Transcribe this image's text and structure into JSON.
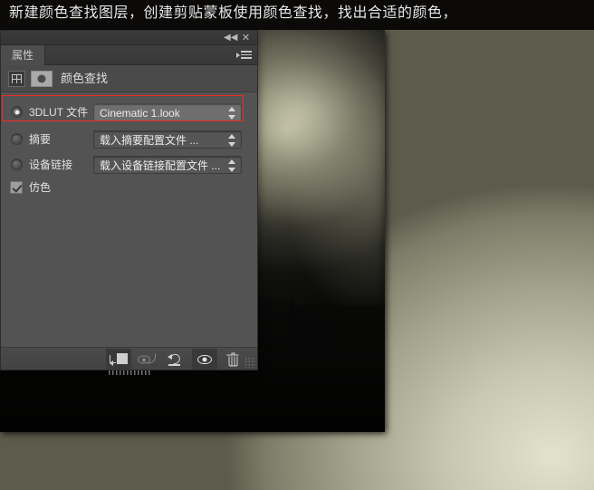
{
  "caption": {
    "text": "新建颜色查找图层，创建剪贴蒙板使用颜色查找，找出合适的颜色，"
  },
  "photo": {
    "alt_name": "dark-abbey-silhouette-photo"
  },
  "panel": {
    "titlebar": {
      "collapse_icon": "◀◀",
      "close_icon": "✕"
    },
    "tab_label": "属性",
    "header": {
      "title": "颜色查找",
      "grid_icon": "lut-grid-icon",
      "adjustment_icon": "adjustment-layer-icon"
    },
    "options": [
      {
        "id": "3dlut",
        "label": "3DLUT 文件",
        "selected": true,
        "value": "Cinematic 1.look",
        "active": true
      },
      {
        "id": "abstract",
        "label": "摘要",
        "selected": false,
        "value": "载入摘要配置文件 ...",
        "active": false
      },
      {
        "id": "devicelink",
        "label": "设备链接",
        "selected": false,
        "value": "载入设备链接配置文件 ...",
        "active": false
      }
    ],
    "dither": {
      "label": "仿色",
      "checked": true
    },
    "highlight_color": "#ee2b24",
    "footer_buttons": [
      {
        "name": "clip-to-layer-button",
        "icon": "clip-to-layer-icon",
        "pressed": true
      },
      {
        "name": "view-previous-state-button",
        "icon": "eye-arrow-icon",
        "pressed": false
      },
      {
        "name": "reset-adjustment-button",
        "icon": "reset-arrow-icon",
        "pressed": false
      },
      {
        "name": "toggle-visibility-button",
        "icon": "eye-icon",
        "pressed": true
      },
      {
        "name": "delete-adjustment-button",
        "icon": "trash-icon",
        "pressed": false
      }
    ]
  },
  "colors": {
    "panel_bg": "#535353",
    "panel_header_bg": "#4a4a4a",
    "titlebar_bg": "#3a3a3a",
    "accent_red": "#ee2b24",
    "text": "#e2e2e2"
  }
}
